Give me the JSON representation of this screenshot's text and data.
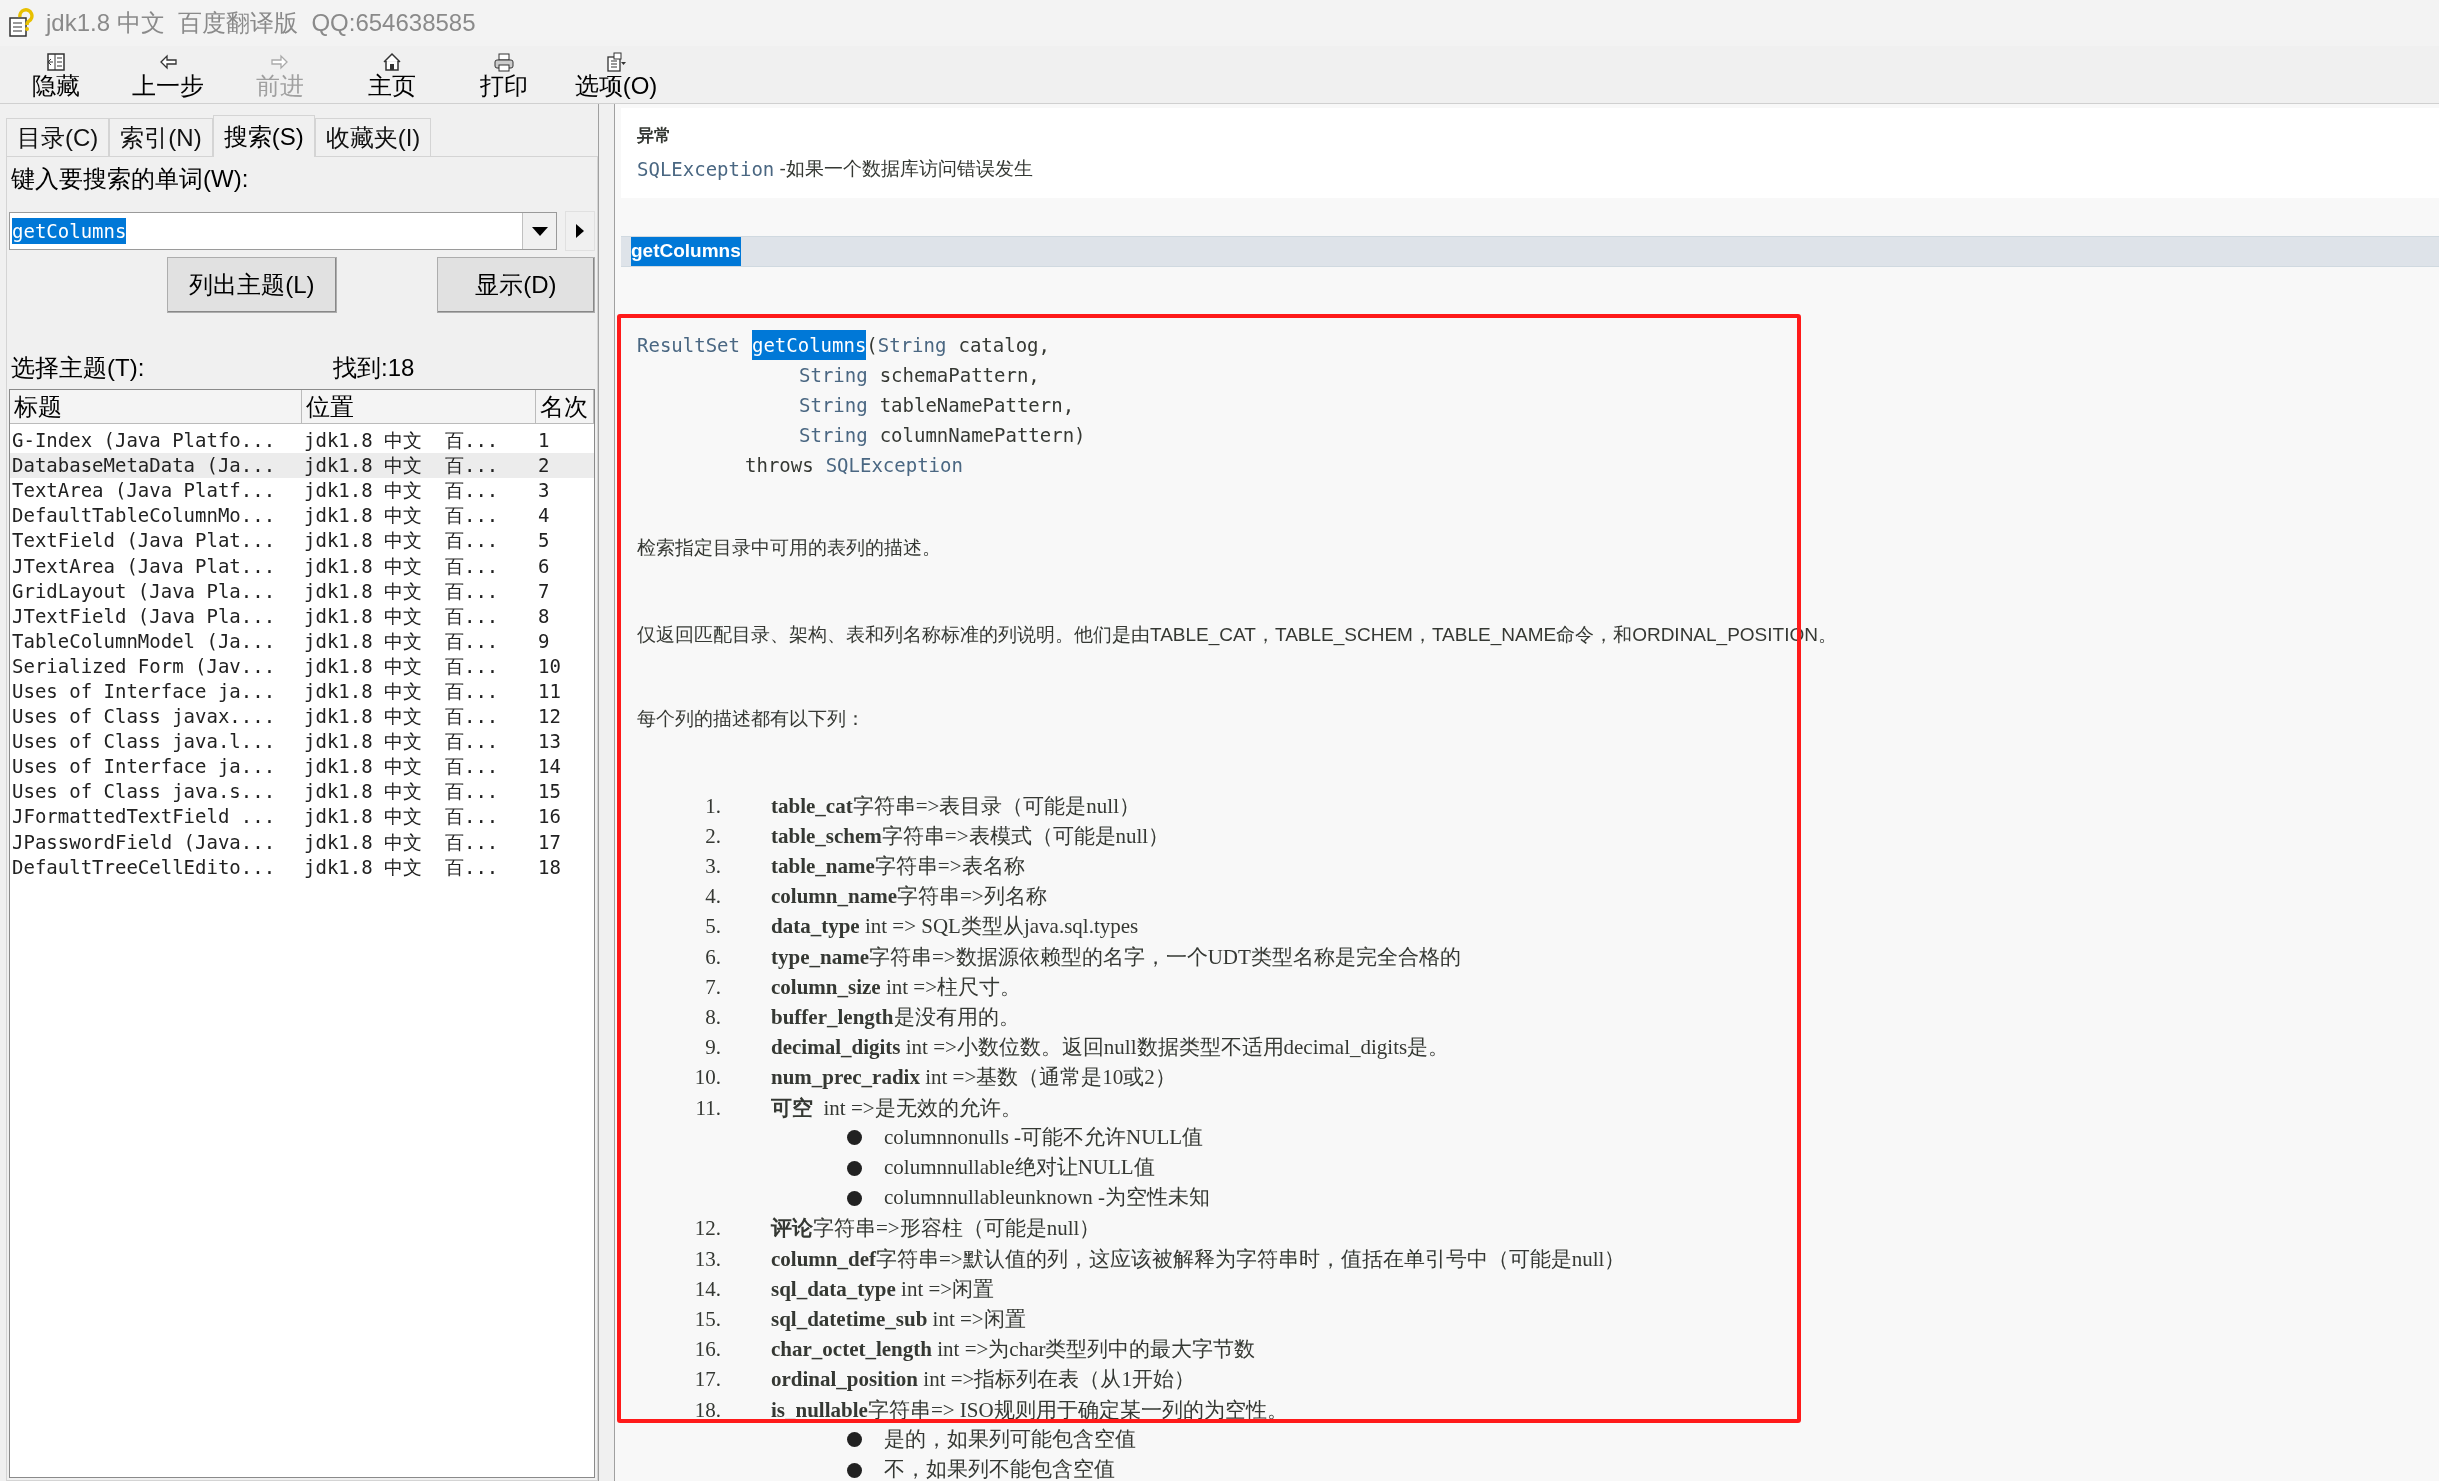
{
  "window": {
    "title": "jdk1.8 中文  百度翻译版  QQ:654638585"
  },
  "toolbar": [
    {
      "kind": "hide",
      "label": "隐藏",
      "disabled": false
    },
    {
      "kind": "back",
      "label": "上一步",
      "disabled": false
    },
    {
      "kind": "forward",
      "label": "前进",
      "disabled": true
    },
    {
      "kind": "home",
      "label": "主页",
      "disabled": false
    },
    {
      "kind": "print",
      "label": "打印",
      "disabled": false
    },
    {
      "kind": "options",
      "label": "选项(O)",
      "disabled": false
    }
  ],
  "tabs": [
    {
      "label": "目录(C)",
      "selected": false
    },
    {
      "label": "索引(N)",
      "selected": false
    },
    {
      "label": "搜索(S)",
      "selected": true
    },
    {
      "label": "收藏夹(I)",
      "selected": false
    }
  ],
  "search": {
    "label": "键入要搜索的单词(W):",
    "value": "getColumns",
    "list_button": "列出主题(L)",
    "display_button": "显示(D)",
    "select_label": "选择主题(T):",
    "found": "找到:18"
  },
  "results": {
    "columns": [
      "标题",
      "位置",
      "名次"
    ],
    "rows": [
      {
        "cells": [
          "G-Index (Java Platfo...",
          "jdk1.8 中文  百...",
          "1"
        ],
        "selected": false
      },
      {
        "cells": [
          "DatabaseMetaData (Ja...",
          "jdk1.8 中文  百...",
          "2"
        ],
        "selected": true
      },
      {
        "cells": [
          "TextArea (Java Platf...",
          "jdk1.8 中文  百...",
          "3"
        ],
        "selected": false
      },
      {
        "cells": [
          "DefaultTableColumnMo...",
          "jdk1.8 中文  百...",
          "4"
        ],
        "selected": false
      },
      {
        "cells": [
          "TextField (Java Plat...",
          "jdk1.8 中文  百...",
          "5"
        ],
        "selected": false
      },
      {
        "cells": [
          "JTextArea (Java Plat...",
          "jdk1.8 中文  百...",
          "6"
        ],
        "selected": false
      },
      {
        "cells": [
          "GridLayout (Java Pla...",
          "jdk1.8 中文  百...",
          "7"
        ],
        "selected": false
      },
      {
        "cells": [
          "JTextField (Java Pla...",
          "jdk1.8 中文  百...",
          "8"
        ],
        "selected": false
      },
      {
        "cells": [
          "TableColumnModel (Ja...",
          "jdk1.8 中文  百...",
          "9"
        ],
        "selected": false
      },
      {
        "cells": [
          "Serialized Form (Jav...",
          "jdk1.8 中文  百...",
          "10"
        ],
        "selected": false
      },
      {
        "cells": [
          "Uses of Interface ja...",
          "jdk1.8 中文  百...",
          "11"
        ],
        "selected": false
      },
      {
        "cells": [
          "Uses of Class javax....",
          "jdk1.8 中文  百...",
          "12"
        ],
        "selected": false
      },
      {
        "cells": [
          "Uses of Class java.l...",
          "jdk1.8 中文  百...",
          "13"
        ],
        "selected": false
      },
      {
        "cells": [
          "Uses of Interface ja...",
          "jdk1.8 中文  百...",
          "14"
        ],
        "selected": false
      },
      {
        "cells": [
          "Uses of Class java.s...",
          "jdk1.8 中文  百...",
          "15"
        ],
        "selected": false
      },
      {
        "cells": [
          "JFormattedTextField ...",
          "jdk1.8 中文  百...",
          "16"
        ],
        "selected": false
      },
      {
        "cells": [
          "JPasswordField (Java...",
          "jdk1.8 中文  百...",
          "17"
        ],
        "selected": false
      },
      {
        "cells": [
          "DefaultTreeCellEdito...",
          "jdk1.8 中文  百...",
          "18"
        ],
        "selected": false
      }
    ]
  },
  "document": {
    "throws_heading": "异常",
    "throws_link": "SQLException",
    "throws_text": " -如果一个数据库访问错误发生",
    "method_heading": "getColumns",
    "signature": {
      "return_type": "ResultSet",
      "method": "getColumns",
      "open": "(",
      "params": [
        {
          "type": "String",
          "name": "catalog,"
        },
        {
          "type": "String",
          "name": "schemaPattern,"
        },
        {
          "type": "String",
          "name": "tableNamePattern,"
        },
        {
          "type": "String",
          "name": "columnNamePattern)"
        }
      ],
      "throws_keyword": "throws",
      "exception": "SQLException"
    },
    "paragraphs": [
      "检索指定目录中可用的表列的描述。",
      "仅返回匹配目录、架构、表和列名称标准的列说明。他们是由TABLE_CAT，TABLE_SCHEM，TABLE_NAME命令，和ORDINAL_POSITION。",
      "每个列的描述都有以下列："
    ],
    "items": [
      {
        "number": "1.",
        "term": "table_cat",
        "text": "字符串=>表目录（可能是null）"
      },
      {
        "number": "2.",
        "term": "table_schem",
        "text": "字符串=>表模式（可能是null）"
      },
      {
        "number": "3.",
        "term": "table_name",
        "text": "字符串=>表名称"
      },
      {
        "number": "4.",
        "term": "column_name",
        "text": "字符串=>列名称"
      },
      {
        "number": "5.",
        "term": "data_type",
        "text": " int => SQL类型从java.sql.types"
      },
      {
        "number": "6.",
        "term": "type_name",
        "text": "字符串=>数据源依赖型的名字，一个UDT类型名称是完全合格的"
      },
      {
        "number": "7.",
        "term": "column_size",
        "text": " int =>柱尺寸。"
      },
      {
        "number": "8.",
        "term": "buffer_length",
        "text": "是没有用的。"
      },
      {
        "number": "9.",
        "term": "decimal_digits",
        "text": " int =>小数位数。返回null数据类型不适用decimal_digits是。"
      },
      {
        "number": "10.",
        "term": "num_prec_radix",
        "text": " int =>基数（通常是10或2）"
      },
      {
        "number": "11.",
        "term": "可空",
        "text": "  int =>是无效的允许。",
        "children": [
          "columnnonulls -可能不允许NULL值",
          "columnnullable绝对让NULL值",
          "columnnullableunknown -为空性未知"
        ]
      },
      {
        "number": "12.",
        "term": "评论",
        "text": "字符串=>形容柱（可能是null）"
      },
      {
        "number": "13.",
        "term": "column_def",
        "text": "字符串=>默认值的列，这应该被解释为字符串时，值括在单引号中（可能是null）"
      },
      {
        "number": "14.",
        "term": "sql_data_type",
        "text": " int =>闲置"
      },
      {
        "number": "15.",
        "term": "sql_datetime_sub",
        "text": " int =>闲置"
      },
      {
        "number": "16.",
        "term": "char_octet_length",
        "text": " int =>为char类型列中的最大字节数"
      },
      {
        "number": "17.",
        "term": "ordinal_position",
        "text": " int =>指标列在表（从1开始）"
      },
      {
        "number": "18.",
        "term": "is_nullable",
        "text": "字符串=> ISO规则用于确定某一列的为空性。",
        "children": [
          "是的，如果列可能包含空值",
          "不，如果列不能包含空值"
        ]
      }
    ]
  }
}
